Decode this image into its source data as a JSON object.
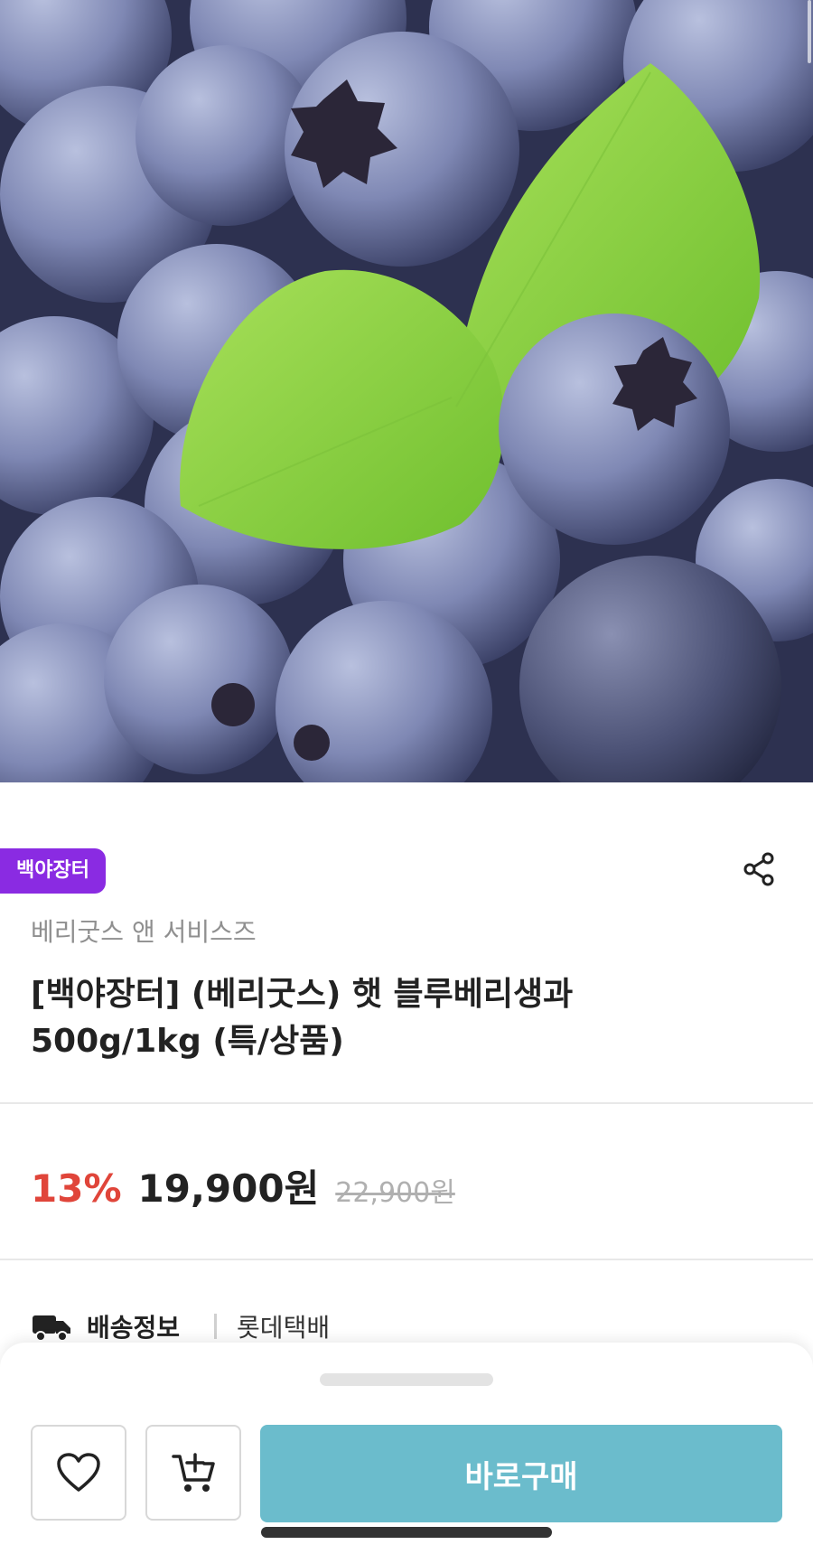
{
  "product": {
    "image_alt": "blueberries with green leaves",
    "badge": "백야장터",
    "seller": "베리굿스 앤 서비스즈",
    "title_line1": "[백야장터] (베리굿스) 햇 블루베리생과",
    "title_line2": "500g/1kg (특/상품)"
  },
  "price": {
    "discount": "13%",
    "sale_price": "19,900원",
    "original_price": "22,900원"
  },
  "shipping": {
    "label": "배송정보",
    "value": "롯데택배"
  },
  "bottom_bar": {
    "buy_label": "바로구매"
  },
  "icons": {
    "share": "share-icon",
    "wishlist": "heart-icon",
    "cart": "cart-add-icon",
    "shipping": "truck-icon"
  },
  "colors": {
    "badge_bg": "#8a2be2",
    "discount": "#e0453a",
    "buy_button": "#6bbccc"
  }
}
